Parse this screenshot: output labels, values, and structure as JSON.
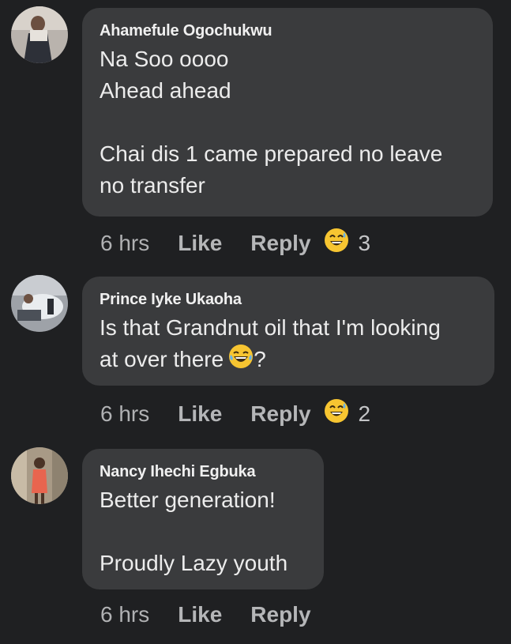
{
  "comments": [
    {
      "author": "Ahamefule Ogochukwu",
      "lines": [
        "Na Soo oooo",
        "Ahead ahead",
        "",
        "Chai dis 1 came prepared no leave",
        "no transfer"
      ],
      "time": "6 hrs",
      "like_label": "Like",
      "reply_label": "Reply",
      "reaction_icon": "grinning-sweat-emoji-icon",
      "reaction_count": "3"
    },
    {
      "author": "Prince Iyke Ukaoha",
      "line1": "Is that Grandnut oil that I'm looking",
      "line2_before": "at over there",
      "line2_emoji": "laughing-tears-emoji-icon",
      "line2_after": "?",
      "time": "6 hrs",
      "like_label": "Like",
      "reply_label": "Reply",
      "reaction_icon": "grinning-sweat-emoji-icon",
      "reaction_count": "2"
    },
    {
      "author": "Nancy Ihechi Egbuka",
      "lines": [
        "Better generation!",
        "",
        "Proudly Lazy youth"
      ],
      "time": "6 hrs",
      "like_label": "Like",
      "reply_label": "Reply"
    }
  ],
  "colors": {
    "background": "#1f2022",
    "bubble": "#3a3b3d",
    "meta_text": "#b5b6b8"
  }
}
